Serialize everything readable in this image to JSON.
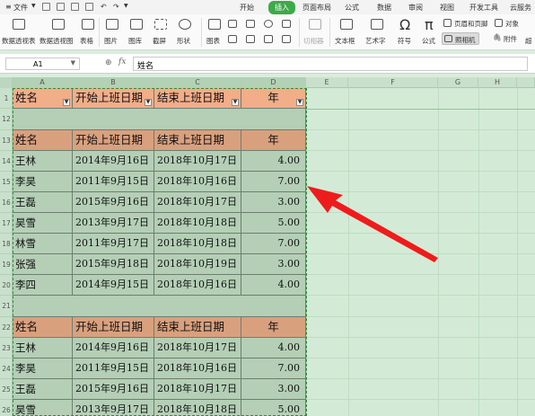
{
  "menubar": {
    "file_label": "文件",
    "tabs": [
      "开始",
      "插入",
      "页面布局",
      "公式",
      "数据",
      "审阅",
      "视图",
      "开发工具",
      "云服务"
    ],
    "active_tab": "插入"
  },
  "ribbon": {
    "items": [
      "数据透视表",
      "数据透视图",
      "表格",
      "图片",
      "图库",
      "截屏",
      "形状",
      "图表",
      "切相器",
      "文本框",
      "艺术字",
      "符号",
      "公式"
    ],
    "small_items": [
      "页眉和页脚",
      "对象",
      "照相机",
      "附件"
    ],
    "trail": [
      "超"
    ]
  },
  "formula_bar": {
    "cell_ref": "A1",
    "fx": "fx",
    "content": "姓名"
  },
  "grid": {
    "columns": [
      "A",
      "B",
      "C",
      "D",
      "E",
      "F",
      "G",
      "H"
    ],
    "rows": [
      "1",
      "12",
      "13",
      "14",
      "15",
      "16",
      "17",
      "18",
      "19",
      "20",
      "21",
      "22",
      "23",
      "24",
      "25",
      "26"
    ]
  },
  "table": {
    "headers": [
      "姓名",
      "开始上班日期",
      "结束上班日期",
      "年"
    ],
    "block1": [
      [
        "王林",
        "2014年9月16日",
        "2018年10月17日",
        "4.00"
      ],
      [
        "李昊",
        "2011年9月15日",
        "2018年10月16日",
        "7.00"
      ],
      [
        "王磊",
        "2015年9月16日",
        "2018年10月17日",
        "3.00"
      ],
      [
        "昊雪",
        "2013年9月17日",
        "2018年10月18日",
        "5.00"
      ],
      [
        "林雪",
        "2011年9月17日",
        "2018年10月18日",
        "7.00"
      ],
      [
        "张强",
        "2015年9月18日",
        "2018年10月19日",
        "3.00"
      ],
      [
        "李四",
        "2014年9月15日",
        "2018年10月16日",
        "4.00"
      ]
    ],
    "block2": [
      [
        "王林",
        "2014年9月16日",
        "2018年10月17日",
        "4.00"
      ],
      [
        "李昊",
        "2011年9月15日",
        "2018年10月16日",
        "7.00"
      ],
      [
        "王磊",
        "2015年9月16日",
        "2018年10月17日",
        "3.00"
      ],
      [
        "昊雪",
        "2013年9月17日",
        "2018年10月18日",
        "5.00"
      ]
    ]
  }
}
